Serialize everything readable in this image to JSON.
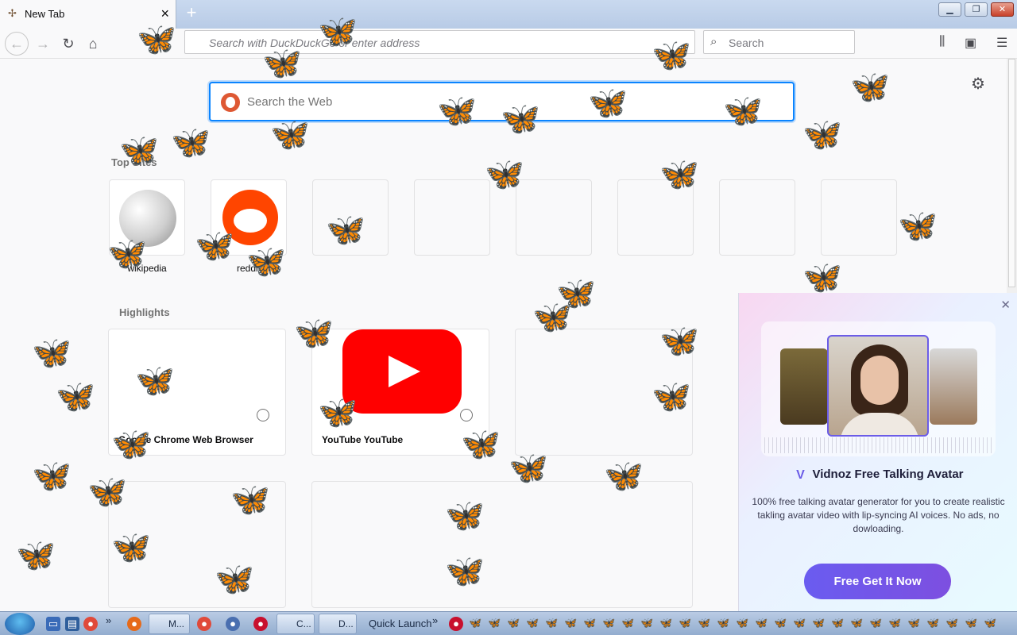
{
  "window": {
    "tab_title": "New Tab",
    "tab_close": "×",
    "new_tab": "+",
    "min": "▁",
    "max": "❐",
    "close": "✕"
  },
  "navbar": {
    "url_placeholder": "Search with DuckDuckGo or enter address",
    "search_placeholder": "Search"
  },
  "content": {
    "web_search_placeholder": "Search the Web",
    "top_sites_title": "Top Sites",
    "top_sites": [
      {
        "label": "wikipedia"
      },
      {
        "label": "reddit"
      }
    ],
    "highlights_title": "Highlights",
    "highlights": [
      {
        "title": "Google Chrome Web Browser"
      },
      {
        "title": "YouTube YouTube"
      }
    ]
  },
  "ad": {
    "close": "✕",
    "brand": "Vidnoz Free Talking Avatar",
    "description": "100% free talking avatar generator for you to create realistic takling avatar video with lip-syncing AI voices. No ads, no dowloading.",
    "cta": "Free Get It Now"
  },
  "taskbar": {
    "buttons": [
      {
        "label": "M..."
      },
      {
        "label": "C..."
      },
      {
        "label": "D..."
      }
    ],
    "quick_launch": "Quick Launch",
    "chevron": "»"
  },
  "icons": {
    "favicon": "butterfly-icon",
    "back": "back-arrow-icon",
    "forward": "forward-arrow-icon",
    "reload": "reload-icon",
    "home": "home-icon",
    "search": "magnifier-icon",
    "library": "library-icon",
    "sidebar": "sidebar-icon",
    "menu": "hamburger-menu-icon",
    "settings": "gear-icon"
  },
  "colors": {
    "accent": "#0a84ff",
    "cta": "#6a5cf0",
    "butterfly": "#e8741a"
  }
}
